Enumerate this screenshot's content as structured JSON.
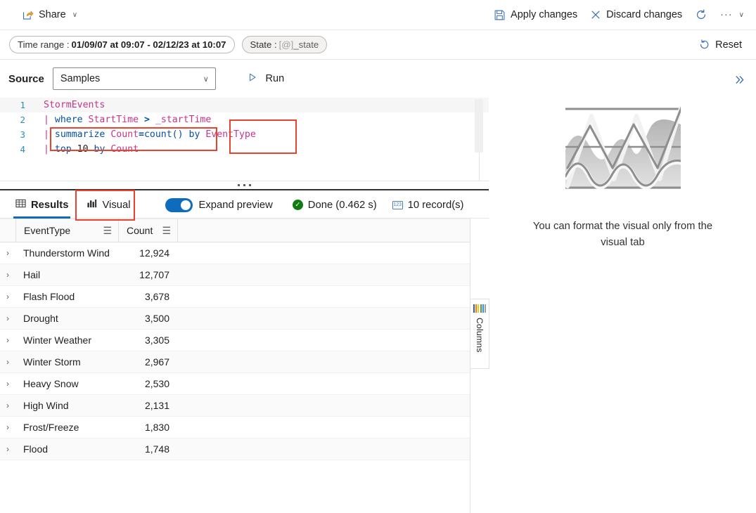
{
  "commandbar": {
    "share": {
      "label": "Share",
      "icon": "share-icon",
      "chevron": "∨"
    },
    "apply": {
      "label": "Apply changes",
      "icon": "save-icon"
    },
    "discard": {
      "label": "Discard changes",
      "icon": "close-icon"
    },
    "refresh": {
      "icon": "refresh-icon"
    },
    "overflow": {
      "label": "···",
      "chevron": "∨"
    }
  },
  "filterbar": {
    "time_range": {
      "label": "Time range :",
      "value": "01/09/07 at 09:07 - 02/12/23 at 10:07"
    },
    "state": {
      "label": "State :",
      "token": "[@]",
      "value": "_state"
    },
    "reset": {
      "label": "Reset",
      "icon": "undo-icon"
    }
  },
  "query": {
    "source_label": "Source",
    "source_value": "Samples",
    "source_chevron": "∨",
    "run_label": "Run",
    "run_icon": "play-triangle-icon",
    "lines": [
      {
        "n": "1",
        "active": true,
        "tokens": [
          {
            "t": "StormEvents",
            "c": "t-table"
          }
        ]
      },
      {
        "n": "2",
        "active": false,
        "tokens": [
          {
            "t": "| ",
            "c": "t-pipe"
          },
          {
            "t": "where",
            "c": "t-kw"
          },
          {
            "t": " ",
            "c": "t-plain"
          },
          {
            "t": "StartTime",
            "c": "t-col"
          },
          {
            "t": " ",
            "c": "t-plain"
          },
          {
            "t": ">",
            "c": "t-op"
          },
          {
            "t": " ",
            "c": "t-plain"
          },
          {
            "t": "_startTime",
            "c": "t-var"
          }
        ]
      },
      {
        "n": "3",
        "active": false,
        "tokens": [
          {
            "t": "| ",
            "c": "t-pipe"
          },
          {
            "t": "summarize",
            "c": "t-kw"
          },
          {
            "t": " ",
            "c": "t-plain"
          },
          {
            "t": "Count",
            "c": "t-col"
          },
          {
            "t": "=",
            "c": "t-op"
          },
          {
            "t": "count()",
            "c": "t-fn"
          },
          {
            "t": " ",
            "c": "t-plain"
          },
          {
            "t": "by",
            "c": "t-kw"
          },
          {
            "t": " ",
            "c": "t-plain"
          },
          {
            "t": "EventType",
            "c": "t-col"
          }
        ]
      },
      {
        "n": "4",
        "active": false,
        "tokens": [
          {
            "t": "| ",
            "c": "t-pipe"
          },
          {
            "t": "top",
            "c": "t-kw"
          },
          {
            "t": " ",
            "c": "t-plain"
          },
          {
            "t": "10",
            "c": "t-num"
          },
          {
            "t": " ",
            "c": "t-plain"
          },
          {
            "t": "by",
            "c": "t-kw"
          },
          {
            "t": " ",
            "c": "t-plain"
          },
          {
            "t": "Count",
            "c": "t-col"
          }
        ]
      }
    ]
  },
  "results": {
    "tabs": [
      {
        "label": "Results",
        "icon": "table-grid-icon",
        "active": true,
        "highlighted": false
      },
      {
        "label": "Visual",
        "icon": "bar-chart-icon",
        "active": false,
        "highlighted": true
      }
    ],
    "expand_preview_label": "Expand preview",
    "expand_preview_on": true,
    "status_label": "Done (0.462 s)",
    "record_count_label": "10 record(s)",
    "columns_tab_label": "Columns",
    "columns_icon_colors": [
      "#3b5ba5",
      "#e08214",
      "#f2c811",
      "#4f9b45",
      "#3b8fd1",
      "#a0a0a0"
    ],
    "grid": {
      "columns": [
        "EventType",
        "Count"
      ],
      "menu_icon": "☰",
      "rows": [
        {
          "event_type": "Thunderstorm Wind",
          "count": "12,924"
        },
        {
          "event_type": "Hail",
          "count": "12,707"
        },
        {
          "event_type": "Flash Flood",
          "count": "3,678"
        },
        {
          "event_type": "Drought",
          "count": "3,500"
        },
        {
          "event_type": "Winter Weather",
          "count": "3,305"
        },
        {
          "event_type": "Winter Storm",
          "count": "2,967"
        },
        {
          "event_type": "Heavy Snow",
          "count": "2,530"
        },
        {
          "event_type": "High Wind",
          "count": "2,131"
        },
        {
          "event_type": "Frost/Freeze",
          "count": "1,830"
        },
        {
          "event_type": "Flood",
          "count": "1,748"
        }
      ]
    }
  },
  "rightpane": {
    "expand_icon": "double-chevron-right-icon",
    "empty_caption": "You can format the visual only from the visual tab",
    "placeholder_icon": "chart-placeholder-icon"
  },
  "annotations": {
    "highlight_color": "#e8432f",
    "boxes": [
      "source-dropdown",
      "run-button",
      "visual-tab"
    ]
  }
}
